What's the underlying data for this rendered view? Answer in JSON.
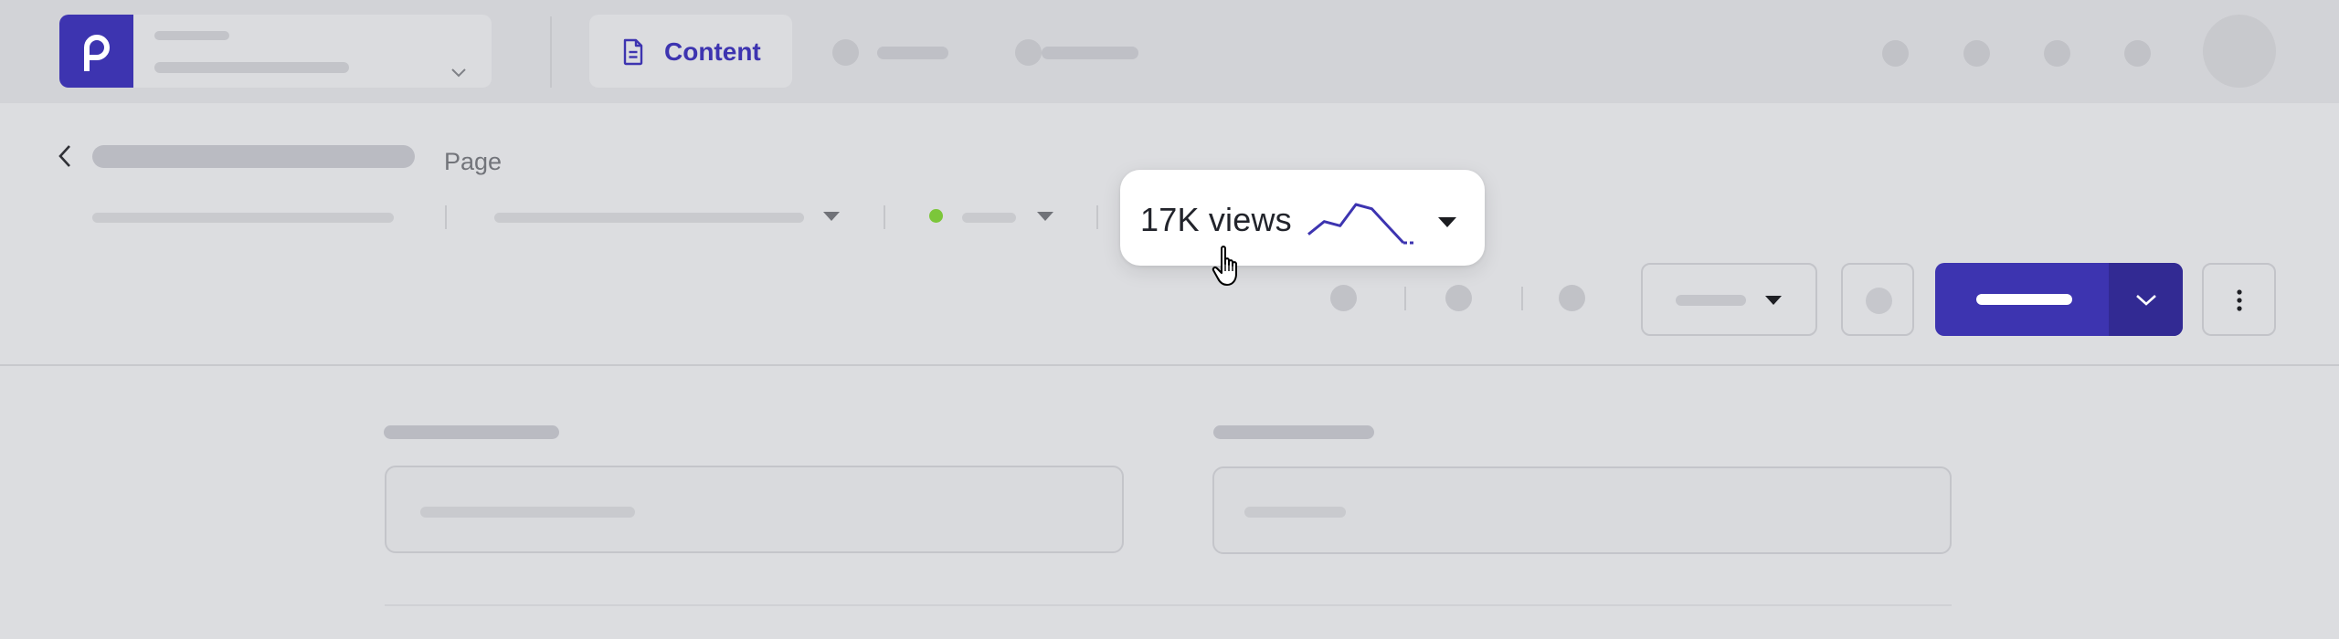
{
  "header": {
    "nav": {
      "content_label": "Content"
    }
  },
  "page": {
    "type_label": "Page"
  },
  "views_popover": {
    "label": "17K views",
    "sparkline": [
      2,
      5,
      4,
      9,
      8,
      4,
      0,
      0
    ],
    "accent_color": "#3d34b0"
  },
  "icons": {
    "brand": "brand-logo-icon",
    "brand_chevron": "chevron-down-icon",
    "content": "document-icon",
    "back": "chevron-left-icon",
    "views_caret": "caret-down-icon",
    "cursor": "hand-pointer-icon",
    "split_chevron": "chevron-down-icon",
    "more": "more-vertical-icon"
  },
  "colors": {
    "brand": "#3d34b0",
    "status_green": "#7cc63a"
  }
}
